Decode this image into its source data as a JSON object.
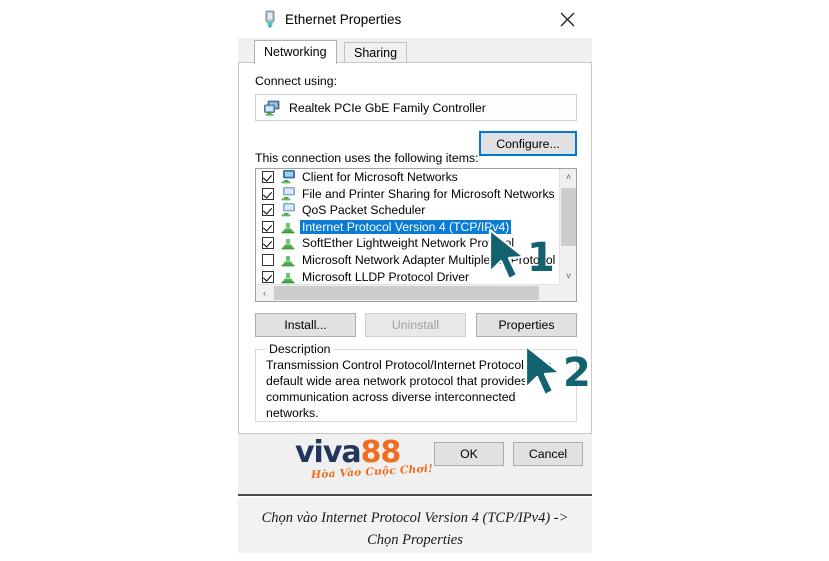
{
  "dialog": {
    "title": "Ethernet Properties",
    "title_icon": "ethernet-connector-icon",
    "close_label": "✕",
    "tabs": [
      {
        "label": "Networking",
        "active": true
      },
      {
        "label": "Sharing",
        "active": false
      }
    ],
    "connect_using_label": "Connect using:",
    "adapter": {
      "name": "Realtek PCIe GbE Family Controller",
      "icon": "network-adapter-icon"
    },
    "configure_label": "Configure...",
    "items_label": "This connection uses the following items:",
    "items": [
      {
        "label": "Client for Microsoft Networks",
        "checked": true,
        "selected": false,
        "icon": "network-client-icon"
      },
      {
        "label": "File and Printer Sharing for Microsoft Networks",
        "checked": true,
        "selected": false,
        "icon": "network-service-icon"
      },
      {
        "label": "QoS Packet Scheduler",
        "checked": true,
        "selected": false,
        "icon": "network-service-icon"
      },
      {
        "label": "Internet Protocol Version 4 (TCP/IPv4)",
        "checked": true,
        "selected": true,
        "icon": "network-protocol-icon"
      },
      {
        "label": "SoftEther Lightweight Network Protocol",
        "checked": true,
        "selected": false,
        "icon": "network-protocol-icon"
      },
      {
        "label": "Microsoft Network Adapter Multiplexor Protocol",
        "checked": false,
        "selected": false,
        "icon": "network-protocol-icon"
      },
      {
        "label": "Microsoft LLDP Protocol Driver",
        "checked": true,
        "selected": false,
        "icon": "network-protocol-icon"
      }
    ],
    "buttons": {
      "install": "Install...",
      "uninstall": "Uninstall",
      "properties": "Properties",
      "ok": "OK",
      "cancel": "Cancel"
    },
    "description_title": "Description",
    "description_text": "Transmission Control Protocol/Internet Protocol. The default wide area network protocol that provides communication across diverse interconnected networks.",
    "scrollbar": {
      "up_arrow": "˄",
      "down_arrow": "˅",
      "left_arrow": "‹",
      "right_arrow": "›"
    }
  },
  "watermark": {
    "word_main": "viva",
    "word_accent": "88",
    "tagline": "Hòa Vào Cuộc Chơi!",
    "color_main": "#24355c",
    "color_accent": "#ee6d1e"
  },
  "annotations": [
    {
      "number": "1",
      "target": "Internet Protocol Version 4 (TCP/IPv4)",
      "color": "#136270"
    },
    {
      "number": "2",
      "target": "Properties",
      "color": "#136270"
    }
  ],
  "caption": {
    "line1": "Chọn vào Internet Protocol Version 4 (TCP/IPv4) ->",
    "line2": "Chọn Properties"
  },
  "theme": {
    "selection_blue": "#0b7bd4",
    "focus_blue": "#0078d7",
    "dialog_bg": "#f0f0f0",
    "panel_bg": "#ffffff"
  }
}
